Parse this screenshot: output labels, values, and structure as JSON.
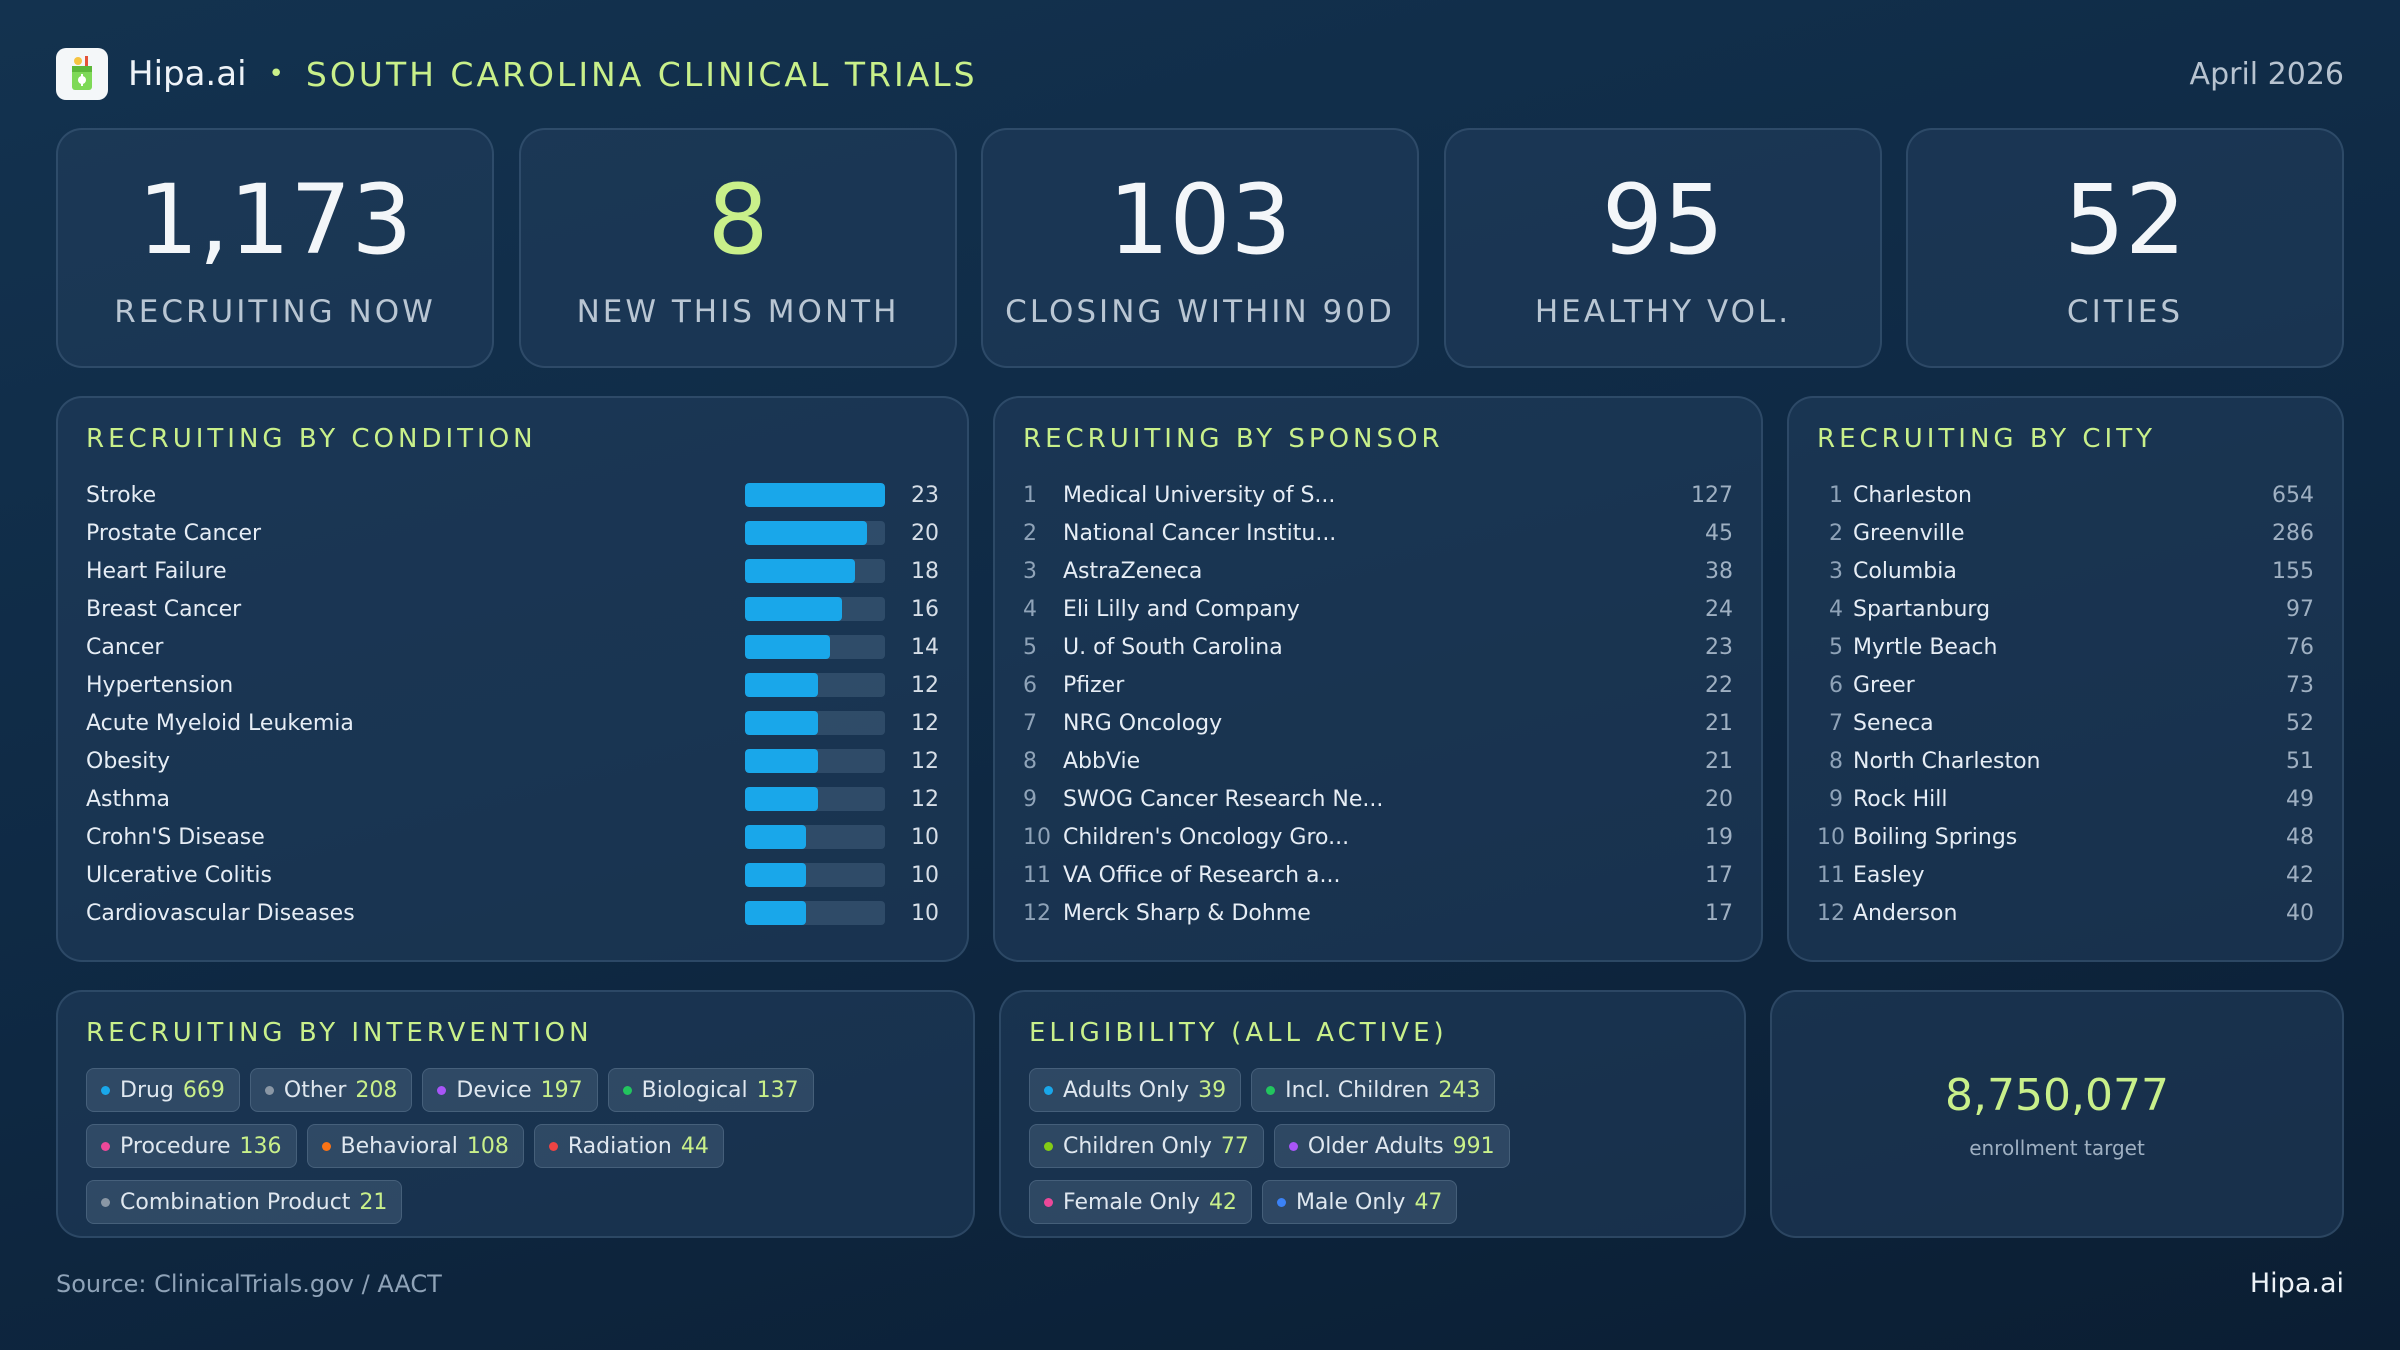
{
  "header": {
    "brand": "Hipa.ai",
    "separator": "•",
    "title": "SOUTH CAROLINA CLINICAL TRIALS",
    "date": "April 2026"
  },
  "kpis": [
    {
      "value": "1,173",
      "label": "RECRUITING NOW"
    },
    {
      "value": "8",
      "label": "NEW THIS MONTH"
    },
    {
      "value": "103",
      "label": "CLOSING WITHIN 90D"
    },
    {
      "value": "95",
      "label": "HEALTHY VOL."
    },
    {
      "value": "52",
      "label": "CITIES"
    }
  ],
  "by_condition": {
    "title": "RECRUITING BY CONDITION",
    "items": [
      {
        "name": "Stroke",
        "count": 23
      },
      {
        "name": "Prostate Cancer",
        "count": 20
      },
      {
        "name": "Heart Failure",
        "count": 18
      },
      {
        "name": "Breast Cancer",
        "count": 16
      },
      {
        "name": "Cancer",
        "count": 14
      },
      {
        "name": "Hypertension",
        "count": 12
      },
      {
        "name": "Acute Myeloid Leukemia",
        "count": 12
      },
      {
        "name": "Obesity",
        "count": 12
      },
      {
        "name": "Asthma",
        "count": 12
      },
      {
        "name": "Crohn'S Disease",
        "count": 10
      },
      {
        "name": "Ulcerative Colitis",
        "count": 10
      },
      {
        "name": "Cardiovascular Diseases",
        "count": 10
      }
    ]
  },
  "by_sponsor": {
    "title": "RECRUITING BY SPONSOR",
    "items": [
      {
        "rank": "1",
        "name": "Medical University of S...",
        "count": "127"
      },
      {
        "rank": "2",
        "name": "National Cancer Institu...",
        "count": "45"
      },
      {
        "rank": "3",
        "name": "AstraZeneca",
        "count": "38"
      },
      {
        "rank": "4",
        "name": "Eli Lilly and Company",
        "count": "24"
      },
      {
        "rank": "5",
        "name": "U. of South Carolina",
        "count": "23"
      },
      {
        "rank": "6",
        "name": "Pfizer",
        "count": "22"
      },
      {
        "rank": "7",
        "name": "NRG Oncology",
        "count": "21"
      },
      {
        "rank": "8",
        "name": "AbbVie",
        "count": "21"
      },
      {
        "rank": "9",
        "name": "SWOG Cancer Research Ne...",
        "count": "20"
      },
      {
        "rank": "10",
        "name": "Children's Oncology Gro...",
        "count": "19"
      },
      {
        "rank": "11",
        "name": "VA Office of Research a...",
        "count": "17"
      },
      {
        "rank": "12",
        "name": "Merck Sharp & Dohme",
        "count": "17"
      }
    ]
  },
  "by_city": {
    "title": "RECRUITING BY CITY",
    "items": [
      {
        "rank": "1",
        "name": "Charleston",
        "count": "654"
      },
      {
        "rank": "2",
        "name": "Greenville",
        "count": "286"
      },
      {
        "rank": "3",
        "name": "Columbia",
        "count": "155"
      },
      {
        "rank": "4",
        "name": "Spartanburg",
        "count": "97"
      },
      {
        "rank": "5",
        "name": "Myrtle Beach",
        "count": "76"
      },
      {
        "rank": "6",
        "name": "Greer",
        "count": "73"
      },
      {
        "rank": "7",
        "name": "Seneca",
        "count": "52"
      },
      {
        "rank": "8",
        "name": "North Charleston",
        "count": "51"
      },
      {
        "rank": "9",
        "name": "Rock Hill",
        "count": "49"
      },
      {
        "rank": "10",
        "name": "Boiling Springs",
        "count": "48"
      },
      {
        "rank": "11",
        "name": "Easley",
        "count": "42"
      },
      {
        "rank": "12",
        "name": "Anderson",
        "count": "40"
      }
    ]
  },
  "by_intervention": {
    "title": "RECRUITING BY INTERVENTION",
    "items": [
      {
        "label": "Drug",
        "value": "669",
        "color": "#19a7ea"
      },
      {
        "label": "Other",
        "value": "208",
        "color": "#8a97a5"
      },
      {
        "label": "Device",
        "value": "197",
        "color": "#a855f7"
      },
      {
        "label": "Biological",
        "value": "137",
        "color": "#22c55e"
      },
      {
        "label": "Procedure",
        "value": "136",
        "color": "#ec4899"
      },
      {
        "label": "Behavioral",
        "value": "108",
        "color": "#f97316"
      },
      {
        "label": "Radiation",
        "value": "44",
        "color": "#ef4444"
      },
      {
        "label": "Combination Product",
        "value": "21",
        "color": "#8a97a5"
      }
    ]
  },
  "eligibility": {
    "title": "ELIGIBILITY (ALL ACTIVE)",
    "items": [
      {
        "label": "Adults Only",
        "value": "39",
        "color": "#19a7ea"
      },
      {
        "label": "Incl. Children",
        "value": "243",
        "color": "#22c55e"
      },
      {
        "label": "Children Only",
        "value": "77",
        "color": "#84cc16"
      },
      {
        "label": "Older Adults",
        "value": "991",
        "color": "#a855f7"
      },
      {
        "label": "Female Only",
        "value": "42",
        "color": "#ec4899"
      },
      {
        "label": "Male Only",
        "value": "47",
        "color": "#3b82f6"
      }
    ]
  },
  "enrollment": {
    "value": "8,750,077",
    "label": "enrollment target"
  },
  "footer": {
    "source": "Source: ClinicalTrials.gov / AACT",
    "brand": "Hipa.ai"
  },
  "colors": {
    "accent": "#c9f08a",
    "bar": "#19a7ea"
  }
}
